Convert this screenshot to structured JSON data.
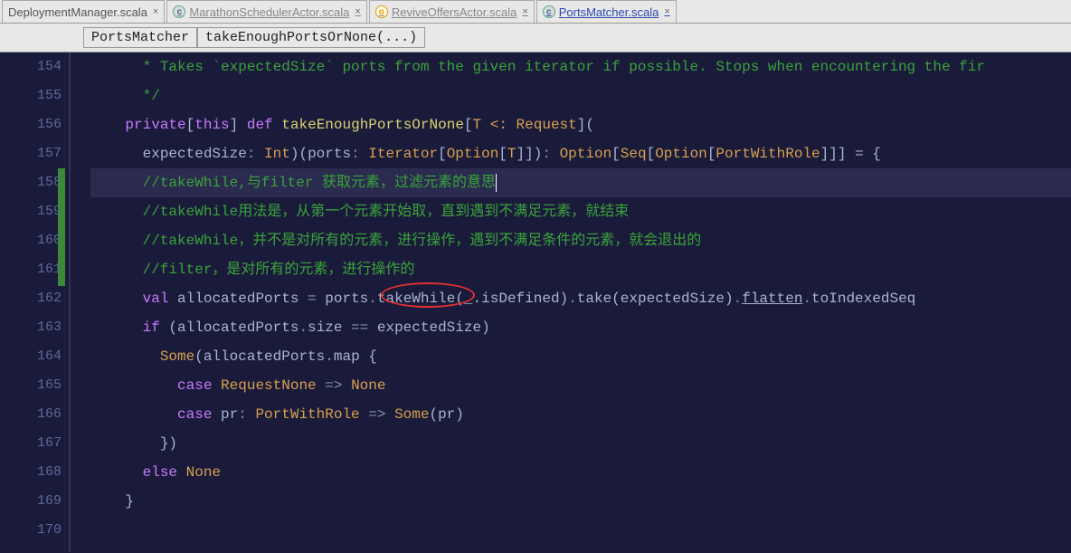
{
  "tabs": [
    {
      "label": "DeploymentManager.scala",
      "icon": "none",
      "active": false,
      "underlined": false
    },
    {
      "label": "MarathonSchedulerActor.scala",
      "icon": "blue-c",
      "active": false,
      "underlined": true
    },
    {
      "label": "ReviveOffersActor.scala",
      "icon": "orange-o",
      "active": false,
      "underlined": true
    },
    {
      "label": "PortsMatcher.scala",
      "icon": "blue-c",
      "active": true,
      "underlined": true
    }
  ],
  "tab_close_glyph": "×",
  "breadcrumbs": [
    "PortsMatcher",
    "takeEnoughPortsOrNone(...)"
  ],
  "gutter": {
    "start": 154,
    "end": 170,
    "current": 158
  },
  "lines": {
    "l154": {
      "indent": "      ",
      "comment": "* Takes `expectedSize` ports from the given iterator if possible. Stops when encountering the fir"
    },
    "l155": {
      "indent": "      ",
      "comment": "*/"
    },
    "l156": {
      "indent": "    ",
      "kw_private": "private",
      "lb": "[",
      "kw_this": "this",
      "rb": "]",
      "kw_def": "def",
      "fn": "takeEnoughPortsOrNone",
      "sig_open": "[",
      "tparam": "T <: Request",
      "sig_close": "]",
      "paren": "("
    },
    "l157": {
      "indent": "      ",
      "p1": "expectedSize",
      "colon1": ": ",
      "t1": "Int",
      "close1": ")",
      "open2": "(",
      "p2": "ports",
      "colon2": ": ",
      "t2a": "Iterator",
      "lb2": "[",
      "t2b": "Option",
      "lb3": "[",
      "t2c": "T",
      "rb3": "]",
      "rb2": "]",
      "close2": ")",
      "colon3": ": ",
      "rt1": "Option",
      "lb4": "[",
      "rt2": "Seq",
      "lb5": "[",
      "rt3": "Option",
      "lb6": "[",
      "rt4": "PortWithRole",
      "rb6": "]",
      "rb5": "]",
      "rb4": "]",
      "eq": " = {",
      "trail": ""
    },
    "l158": {
      "indent": "      ",
      "comment": "//takeWhile,与filter 获取元素，过滤元素的意思"
    },
    "l159": {
      "indent": "      ",
      "comment": "//takeWhile用法是，从第一个元素开始取，直到遇到不满足元素，就结束"
    },
    "l160": {
      "indent": "      ",
      "comment": "//takeWhile，并不是对所有的元素，进行操作，遇到不满足条件的元素，就会退出的"
    },
    "l161": {
      "indent": "      ",
      "comment": "//filter，是对所有的元素，进行操作的"
    },
    "l162": {
      "indent": "      ",
      "kw_val": "val",
      "name": "allocatedPorts",
      "eq": " = ",
      "obj": "ports",
      "dot1": ".",
      "m1": "takeWhile",
      "op1": "(",
      "arg1": "_.isDefined",
      "cp1": ")",
      "dot2": ".",
      "m2": "take",
      "op2": "(",
      "arg2": "expectedSize",
      "cp2": ")",
      "dot3": ".",
      "m3": "flatten",
      "dot4": ".",
      "m4": "toIndexedSeq"
    },
    "l163": {
      "indent": "      ",
      "kw_if": "if",
      "open": " (",
      "a": "allocatedPorts",
      "dot": ".",
      "m": "size",
      "op": " == ",
      "b": "expectedSize",
      "close": ")"
    },
    "l164": {
      "indent": "        ",
      "fn": "Some",
      "open": "(",
      "a": "allocatedPorts",
      "dot": ".",
      "m": "map",
      "brace": " {"
    },
    "l165": {
      "indent": "          ",
      "kw_case": "case",
      "sp": " ",
      "pat": "RequestNone",
      "arrow": " => ",
      "res": "None"
    },
    "l166": {
      "indent": "          ",
      "kw_case": "case",
      "sp": " ",
      "pat_name": "pr",
      "colon": ": ",
      "pat_type": "PortWithRole",
      "arrow": " => ",
      "fn": "Some",
      "open": "(",
      "arg": "pr",
      "close": ")"
    },
    "l167": {
      "indent": "        ",
      "text": "})"
    },
    "l168": {
      "indent": "      ",
      "kw_else": "else",
      "sp": " ",
      "res": "None"
    },
    "l169": {
      "indent": "    ",
      "text": "}"
    },
    "l170": {
      "indent": "",
      "text": ""
    }
  }
}
